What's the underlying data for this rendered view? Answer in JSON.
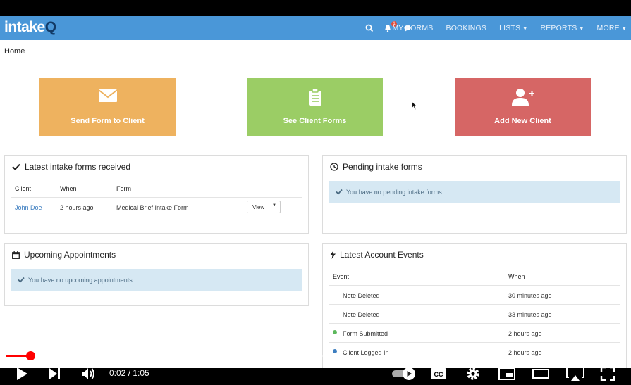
{
  "app": {
    "logo_main": "intake",
    "logo_accent": "Q",
    "notification_count": "1",
    "nav": [
      "MY FORMS",
      "BOOKINGS",
      "LISTS",
      "REPORTS",
      "MORE"
    ],
    "nav_has_caret": [
      false,
      false,
      true,
      true,
      true
    ],
    "breadcrumb": "Home"
  },
  "tiles": {
    "send": "Send Form to Client",
    "see": "See Client Forms",
    "add": "Add New Client",
    "colors": {
      "send": "#eeb25f",
      "see": "#9bcd65",
      "add": "#d66665"
    }
  },
  "latest_forms": {
    "title": "Latest intake forms received",
    "columns": [
      "Client",
      "When",
      "Form"
    ],
    "rows": [
      {
        "client": "John Doe",
        "when": "2 hours ago",
        "form": "Medical Brief Intake Form",
        "action": "View"
      }
    ]
  },
  "pending_forms": {
    "title": "Pending intake forms",
    "message": "You have no pending intake forms."
  },
  "appointments": {
    "title": "Upcoming Appointments",
    "message": "You have no upcoming appointments."
  },
  "account_events": {
    "title": "Latest Account Events",
    "columns": [
      "Event",
      "When"
    ],
    "rows": [
      {
        "event": "Note Deleted",
        "when": "30 minutes ago",
        "dot": ""
      },
      {
        "event": "Note Deleted",
        "when": "33 minutes ago",
        "dot": ""
      },
      {
        "event": "Form Submitted",
        "when": "2 hours ago",
        "dot": "#5cb85c"
      },
      {
        "event": "Client Logged In",
        "when": "2 hours ago",
        "dot": "#3d7ec0"
      }
    ]
  },
  "player": {
    "time": "0:02 / 1:05",
    "progress": 0.04
  }
}
